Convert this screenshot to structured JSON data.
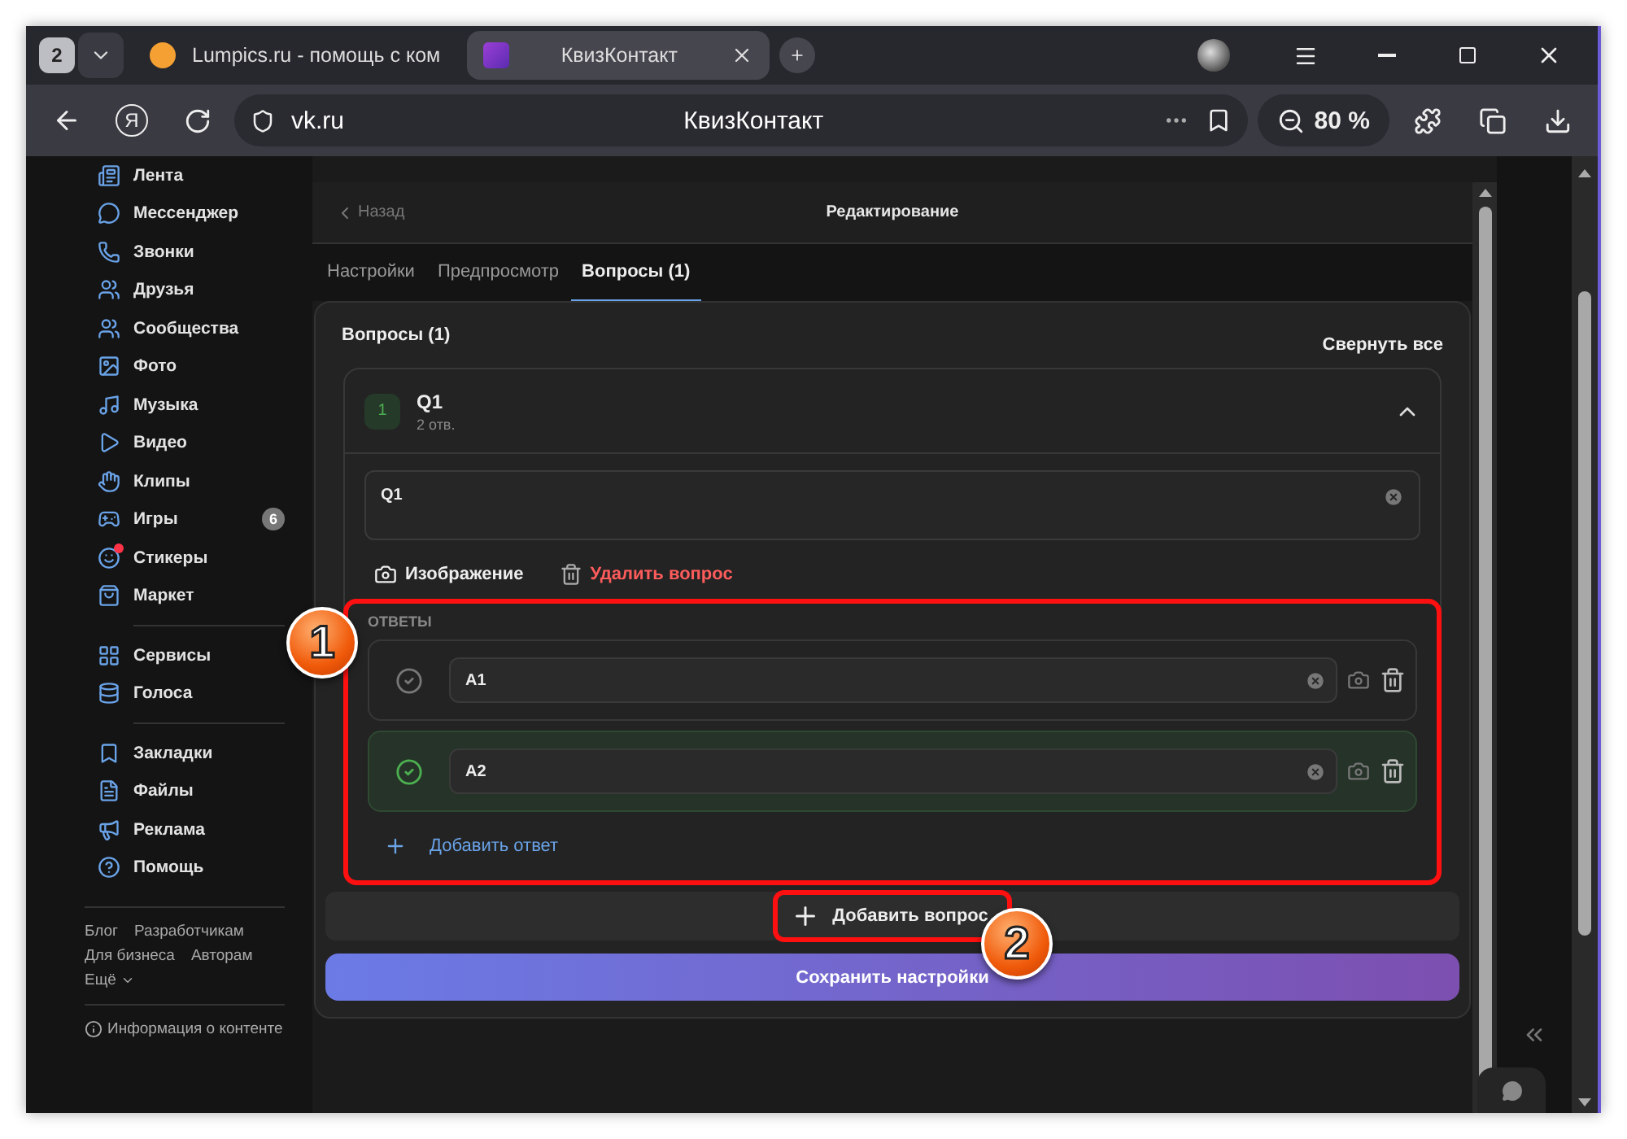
{
  "browser": {
    "tab_count": "2",
    "tabs": [
      {
        "title": "Lumpics.ru - помощь с ком",
        "selected": false
      },
      {
        "title": "КвизКонтакт",
        "selected": true
      }
    ],
    "yandex_button": "Я",
    "address": "vk.ru",
    "page_title": "КвизКонтакт",
    "zoom": "80 %"
  },
  "sidebar": {
    "groups": [
      [
        {
          "label": "Лента"
        },
        {
          "label": "Мессенджер"
        },
        {
          "label": "Звонки"
        },
        {
          "label": "Друзья"
        },
        {
          "label": "Сообщества"
        },
        {
          "label": "Фото"
        },
        {
          "label": "Музыка"
        },
        {
          "label": "Видео"
        },
        {
          "label": "Клипы"
        },
        {
          "label": "Игры",
          "badge": "6"
        },
        {
          "label": "Стикеры",
          "dot": true
        },
        {
          "label": "Маркет"
        }
      ],
      [
        {
          "label": "Сервисы"
        },
        {
          "label": "Голоса"
        }
      ],
      [
        {
          "label": "Закладки"
        },
        {
          "label": "Файлы"
        },
        {
          "label": "Реклама"
        },
        {
          "label": "Помощь"
        }
      ]
    ],
    "footer_links": [
      [
        "Блог",
        "Разработчикам"
      ],
      [
        "Для бизнеса",
        "Авторам"
      ],
      [
        "Ещё"
      ]
    ],
    "info": "Информация о контенте"
  },
  "editor": {
    "back": "Назад",
    "title": "Редактирование",
    "tabs": [
      {
        "label": "Настройки",
        "selected": false
      },
      {
        "label": "Предпросмотр",
        "selected": false
      },
      {
        "label": "Вопросы (1)",
        "selected": true
      }
    ],
    "section_title": "Вопросы (1)",
    "collapse_all": "Свернуть все",
    "question": {
      "number": "1",
      "title": "Q1",
      "subtitle": "2 отв.",
      "expanded": true,
      "text": "Q1",
      "image_label": "Изображение",
      "delete_label": "Удалить вопрос",
      "answers_label": "ОТВЕТЫ",
      "highlighted": true,
      "marker": "1",
      "answers": [
        {
          "text": "A1",
          "correct": false
        },
        {
          "text": "A2",
          "correct": true
        }
      ],
      "add_answer": "Добавить ответ"
    },
    "add_question": {
      "label": "Добавить вопрос",
      "highlighted": true,
      "marker": "2"
    },
    "save": "Сохранить настройки"
  }
}
